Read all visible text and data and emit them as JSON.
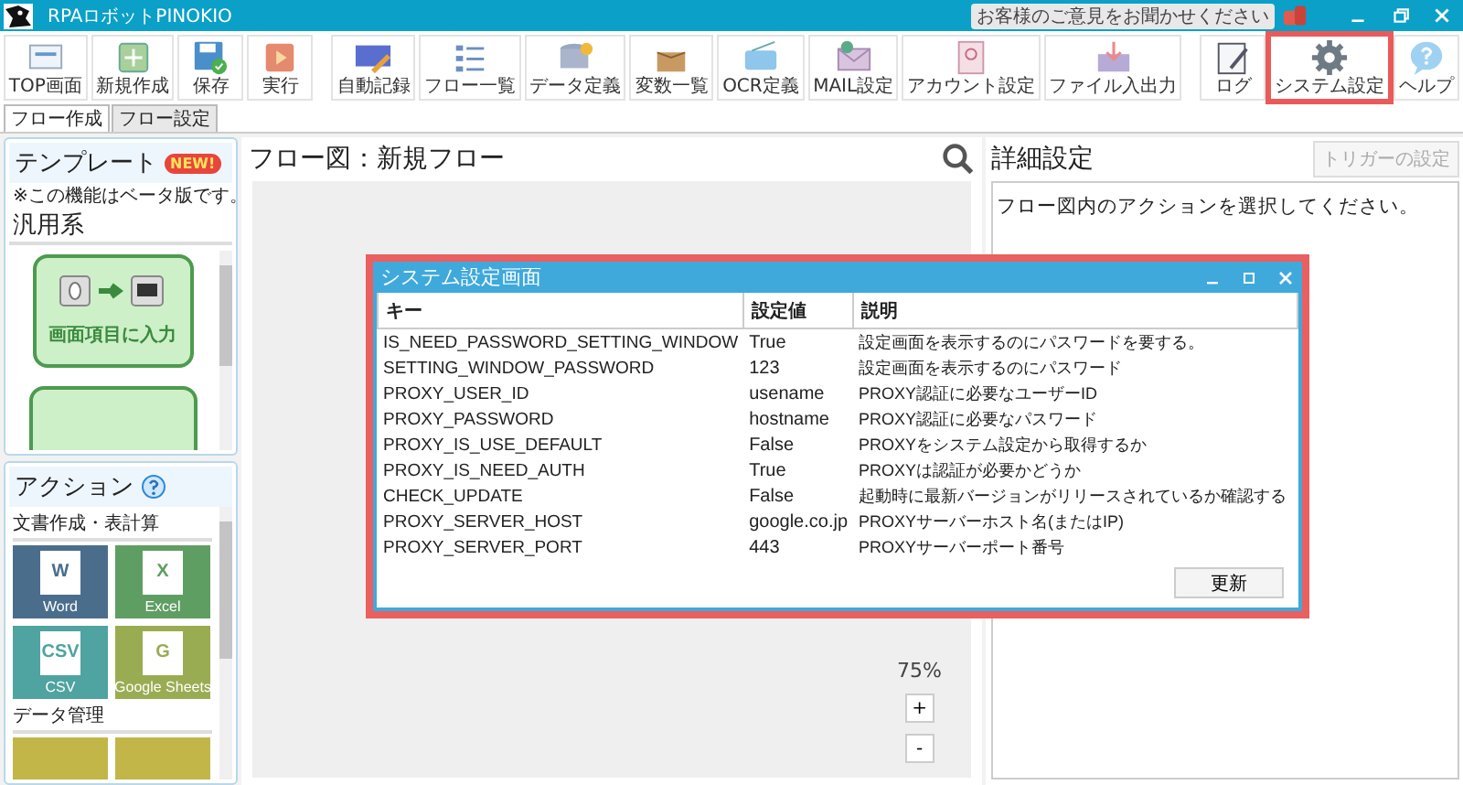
{
  "window": {
    "title": "RPAロボットPINOKIO",
    "feedback": "お客様のご意見をお聞かせください"
  },
  "toolbar": [
    {
      "label": "TOP画面",
      "kind": "top",
      "highlighted": false
    },
    {
      "label": "新規作成",
      "kind": "new",
      "highlighted": false
    },
    {
      "label": "保存",
      "kind": "save",
      "highlighted": false
    },
    {
      "label": "実行",
      "kind": "run",
      "highlighted": false
    },
    {
      "label": "自動記録",
      "kind": "record",
      "highlighted": false
    },
    {
      "label": "フロー一覧",
      "kind": "list",
      "highlighted": false
    },
    {
      "label": "データ定義",
      "kind": "data",
      "highlighted": false
    },
    {
      "label": "変数一覧",
      "kind": "vars",
      "highlighted": false
    },
    {
      "label": "OCR定義",
      "kind": "ocr",
      "highlighted": false
    },
    {
      "label": "MAIL設定",
      "kind": "mail",
      "highlighted": false
    },
    {
      "label": "アカウント設定",
      "kind": "account",
      "highlighted": false
    },
    {
      "label": "ファイル入出力",
      "kind": "file",
      "highlighted": false
    },
    {
      "label": "ログ",
      "kind": "log",
      "highlighted": false
    },
    {
      "label": "システム設定",
      "kind": "settings",
      "highlighted": true
    },
    {
      "label": "ヘルプ",
      "kind": "help",
      "highlighted": false
    }
  ],
  "tabs": [
    {
      "label": "フロー作成",
      "selected": true
    },
    {
      "label": "フロー設定",
      "selected": false
    }
  ],
  "templates": {
    "title": "テンプレート",
    "badge": "NEW!",
    "note": "※この機能はベータ版です。",
    "category": "汎用系",
    "cards": [
      {
        "label": "画面項目に入力"
      }
    ]
  },
  "actions": {
    "title": "アクション",
    "groups": [
      {
        "name": "文書作成・表計算",
        "tiles": [
          {
            "label": "Word",
            "letter": "W",
            "color": "#4a6d8c"
          },
          {
            "label": "Excel",
            "letter": "X",
            "color": "#5f9e62"
          },
          {
            "label": "CSV",
            "letter": "CSV",
            "color": "#4fa3a0"
          },
          {
            "label": "Google Sheets",
            "letter": "G",
            "color": "#9aac52"
          }
        ]
      },
      {
        "name": "データ管理",
        "tiles": [
          {
            "color": "#c2b649"
          },
          {
            "color": "#c2b649"
          }
        ]
      }
    ]
  },
  "flow": {
    "title": "フロー図：新規フロー",
    "zoom": "75%",
    "zoom_in": "+",
    "zoom_out": "-"
  },
  "details": {
    "title": "詳細設定",
    "trigger_button": {
      "label": "トリガーの設定",
      "disabled": true
    },
    "message": "フロー図内のアクションを選択してください。"
  },
  "dialog": {
    "title": "システム設定画面",
    "highlighted": true,
    "columns": [
      "キー",
      "設定値",
      "説明"
    ],
    "rows": [
      {
        "key": "IS_NEED_PASSWORD_SETTING_WINDOW",
        "value": "True",
        "description": "設定画面を表示するのにパスワードを要する。"
      },
      {
        "key": "SETTING_WINDOW_PASSWORD",
        "value": "123",
        "description": "設定画面を表示するのにパスワード"
      },
      {
        "key": "PROXY_USER_ID",
        "value": "usename",
        "description": "PROXY認証に必要なユーザーID"
      },
      {
        "key": "PROXY_PASSWORD",
        "value": "hostname",
        "description": "PROXY認証に必要なパスワード"
      },
      {
        "key": "PROXY_IS_USE_DEFAULT",
        "value": "False",
        "description": "PROXYをシステム設定から取得するか"
      },
      {
        "key": "PROXY_IS_NEED_AUTH",
        "value": "True",
        "description": "PROXYは認証が必要かどうか"
      },
      {
        "key": "CHECK_UPDATE",
        "value": "False",
        "description": "起動時に最新バージョンがリリースされているか確認する"
      },
      {
        "key": "PROXY_SERVER_HOST",
        "value": "google.co.jp",
        "description": "PROXYサーバーホスト名(またはIP)"
      },
      {
        "key": "PROXY_SERVER_PORT",
        "value": "443",
        "description": "PROXYサーバーポート番号"
      }
    ],
    "button": "更新"
  }
}
